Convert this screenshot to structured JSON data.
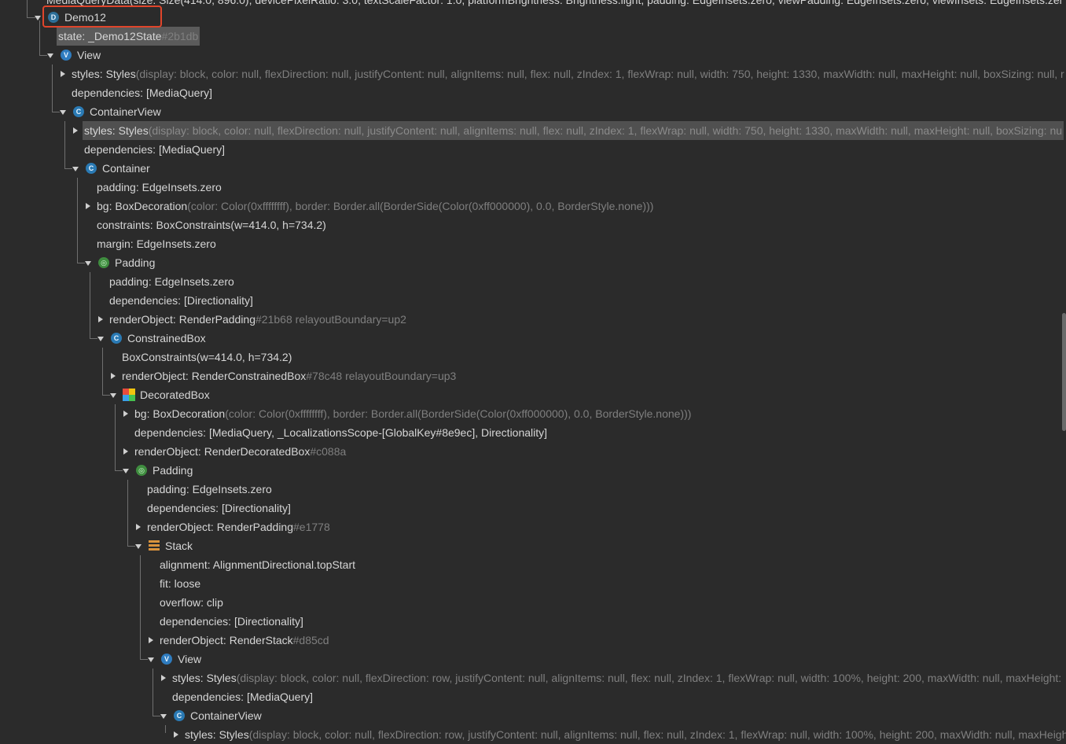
{
  "rows": [
    {
      "text": "MediaQueryData(size: Size(414.0, 896.0), devicePixelRatio: 3.0, textScaleFactor: 1.0, platformBrightness: Brightness.light, padding: EdgeInsets.zero, viewPadding: EdgeInsets.zero, viewInsets: EdgeInsets.zer"
    },
    {
      "icon": "D",
      "icon_name": "demo-icon",
      "label": "Demo12"
    },
    {
      "label": "state: _Demo12State",
      "suffix": "#2b1db"
    },
    {
      "icon": "V",
      "icon_name": "view-icon",
      "label": "View"
    },
    {
      "label": "styles: Styles",
      "suffix": "(display: block, color: null, flexDirection: null, justifyContent: null, alignItems: null, flex: null, zIndex: 1, flexWrap: null, width: 750, height: 1330, maxWidth: null, maxHeight: null, boxSizing: null, r"
    },
    {
      "label": "dependencies: [MediaQuery]"
    },
    {
      "icon": "C",
      "icon_name": "component-icon",
      "label": "ContainerView"
    },
    {
      "label": "styles: Styles",
      "suffix": "(display: block, color: null, flexDirection: null, justifyContent: null, alignItems: null, flex: null, zIndex: 1, flexWrap: null, width: 750, height: 1330, maxWidth: null, maxHeight: null, boxSizing: nu"
    },
    {
      "label": "dependencies: [MediaQuery]"
    },
    {
      "icon": "C",
      "icon_name": "component-icon",
      "label": "Container"
    },
    {
      "label": "padding: EdgeInsets.zero"
    },
    {
      "label": "bg: BoxDecoration",
      "suffix": "(color: Color(0xffffffff), border: Border.all(BorderSide(Color(0xff000000), 0.0, BorderStyle.none)))"
    },
    {
      "label": "constraints: BoxConstraints(w=414.0, h=734.2)"
    },
    {
      "label": "margin: EdgeInsets.zero"
    },
    {
      "icon": "◎",
      "icon_name": "padding-icon",
      "label": "Padding"
    },
    {
      "label": "padding: EdgeInsets.zero"
    },
    {
      "label": "dependencies: [Directionality]"
    },
    {
      "label": "renderObject: RenderPadding",
      "suffix": "#21b68 relayoutBoundary=up2"
    },
    {
      "icon": "C",
      "icon_name": "component-icon",
      "label": "ConstrainedBox"
    },
    {
      "label": "BoxConstraints(w=414.0, h=734.2)"
    },
    {
      "label": "renderObject: RenderConstrainedBox",
      "suffix": "#78c48 relayoutBoundary=up3"
    },
    {
      "icon": "",
      "icon_name": "decorated-box-icon",
      "label": "DecoratedBox"
    },
    {
      "label": "bg: BoxDecoration",
      "suffix": "(color: Color(0xffffffff), border: Border.all(BorderSide(Color(0xff000000), 0.0, BorderStyle.none)))"
    },
    {
      "label": "dependencies: [MediaQuery, _LocalizationsScope-[GlobalKey#8e9ec], Directionality]"
    },
    {
      "label": "renderObject: RenderDecoratedBox",
      "suffix": "#c088a"
    },
    {
      "icon": "◎",
      "icon_name": "padding-icon",
      "label": "Padding"
    },
    {
      "label": "padding: EdgeInsets.zero"
    },
    {
      "label": "dependencies: [Directionality]"
    },
    {
      "label": "renderObject: RenderPadding",
      "suffix": "#e1778"
    },
    {
      "icon": "",
      "icon_name": "stack-icon",
      "label": "Stack"
    },
    {
      "label": "alignment: AlignmentDirectional.topStart"
    },
    {
      "label": "fit: loose"
    },
    {
      "label": "overflow: clip"
    },
    {
      "label": "dependencies: [Directionality]"
    },
    {
      "label": "renderObject: RenderStack",
      "suffix": "#d85cd"
    },
    {
      "icon": "V",
      "icon_name": "view-icon",
      "label": "View"
    },
    {
      "label": "styles: Styles",
      "suffix": "(display: block, color: null, flexDirection: row, justifyContent: null, alignItems: null, flex: null, zIndex: 1, flexWrap: null, width: 100%, height: 200, maxWidth: null, maxHeight:"
    },
    {
      "label": "dependencies: [MediaQuery]"
    },
    {
      "icon": "C",
      "icon_name": "component-icon",
      "label": "ContainerView"
    },
    {
      "label": "styles: Styles",
      "suffix": "(display: block, color: null, flexDirection: row, justifyContent: null, alignItems: null, flex: null, zIndex: 1, flexWrap: null, width: 100%, height: 200, maxWidth: null, maxHeigh"
    }
  ],
  "colors": {
    "background": "#2b2b2b",
    "text": "#d6d6d6",
    "dim_text": "#7f7f7f",
    "highlight": "#e0452b"
  }
}
